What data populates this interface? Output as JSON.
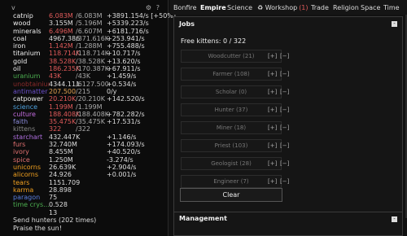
{
  "header": {
    "toggle": "v",
    "gear_icon": "⚙",
    "help": "?"
  },
  "resources": [
    {
      "name": "catnip",
      "value": "6.083M",
      "max": "/6.083M",
      "rate": "+3891.154/s [+50%]",
      "color": "#e05a5a",
      "ncolor": "#eee"
    },
    {
      "name": "wood",
      "value": "3.155M",
      "max": "/5.196M",
      "rate": "+5339.223/s",
      "color": "#ddd",
      "ncolor": "#eee"
    },
    {
      "name": "minerals",
      "value": "6.496M",
      "max": "/6.607M",
      "rate": "+6181.716/s",
      "color": "#e05a5a",
      "ncolor": "#eee"
    },
    {
      "name": "coal",
      "value": "4967.386",
      "max": "/371.616K",
      "rate": "+253.941/s",
      "color": "#ddd",
      "ncolor": "#eee"
    },
    {
      "name": "iron",
      "value": "1.142M",
      "max": "/1.288M",
      "rate": "+755.488/s",
      "color": "#e05a5a",
      "ncolor": "#eee"
    },
    {
      "name": "titanium",
      "value": "118.714K",
      "max": "/118.714K",
      "rate": "+10.717/s",
      "color": "#e05a5a",
      "ncolor": "#eee"
    },
    {
      "name": "gold",
      "value": "38.528K",
      "max": "/38.528K",
      "rate": "+13.620/s",
      "color": "#e05a5a",
      "ncolor": "#eee"
    },
    {
      "name": "oil",
      "value": "186.235K",
      "max": "/170.387K",
      "rate": "+67.911/s",
      "color": "#e05a5a",
      "ncolor": "#eee"
    },
    {
      "name": "uranium",
      "value": "43K",
      "max": "/43K",
      "rate": "+1.459/s",
      "color": "#e05a5a",
      "ncolor": "#4caf50"
    },
    {
      "name": "unobtainium",
      "value": "4344.111",
      "max": "/6127.500",
      "rate": "+0.534/s",
      "color": "#ddd",
      "ncolor": "#8b2a2a"
    },
    {
      "name": "antimatter",
      "value": "207.500",
      "max": "/215",
      "rate": "0/y",
      "color": "#e0a050",
      "ncolor": "#6a4fc8"
    },
    {
      "name": "catpower",
      "value": "20.210K",
      "max": "/20.210K",
      "rate": "+142.520/s",
      "color": "#e05a5a",
      "ncolor": "#eee"
    },
    {
      "name": "science",
      "value": "1.199M",
      "max": "/1.199M",
      "rate": "",
      "color": "#e05a5a",
      "ncolor": "#4fa3e0"
    },
    {
      "name": "culture",
      "value": "188.408K",
      "max": "/188.408K",
      "rate": "+782.282/s",
      "color": "#e05a5a",
      "ncolor": "#c56de0"
    },
    {
      "name": "faith",
      "value": "35.475K",
      "max": "/35.475K",
      "rate": "+17.531/s",
      "color": "#e05a5a",
      "ncolor": "#8a8ad8"
    },
    {
      "name": "kittens",
      "value": "322",
      "max": "/322",
      "rate": "",
      "color": "#e05a5a",
      "ncolor": "#888"
    },
    {
      "name": "starchart",
      "value": "432.447K",
      "max": "",
      "rate": "+1.146/s",
      "color": "#ddd",
      "ncolor": "#b070e0"
    },
    {
      "name": "furs",
      "value": "32.740M",
      "max": "",
      "rate": "+174.093/s",
      "color": "#ddd",
      "ncolor": "#e07070"
    },
    {
      "name": "ivory",
      "value": "8.455M",
      "max": "",
      "rate": "+40.520/s",
      "color": "#ddd",
      "ncolor": "#e07070"
    },
    {
      "name": "spice",
      "value": "1.250M",
      "max": "",
      "rate": "-3.274/s",
      "color": "#ddd",
      "ncolor": "#e07070"
    },
    {
      "name": "unicorns",
      "value": "26.639K",
      "max": "",
      "rate": "+2.904/s",
      "color": "#ddd",
      "ncolor": "#f0a020"
    },
    {
      "name": "alicorns",
      "value": "24.926",
      "max": "",
      "rate": "+0.001/s",
      "color": "#ddd",
      "ncolor": "#f0a020"
    },
    {
      "name": "tears",
      "value": "1151.709",
      "max": "",
      "rate": "",
      "color": "#ddd",
      "ncolor": "#f0a020"
    },
    {
      "name": "karma",
      "value": "28.898",
      "max": "",
      "rate": "",
      "color": "#ddd",
      "ncolor": "#f0a020"
    },
    {
      "name": "paragon",
      "value": "75",
      "max": "",
      "rate": "",
      "color": "#ddd",
      "ncolor": "#5a7fe0"
    },
    {
      "name": "time crys...",
      "value": "0.528",
      "max": "",
      "rate": "",
      "color": "#ddd",
      "ncolor": "#4caf50"
    },
    {
      "name": "",
      "value": "13",
      "max": "",
      "rate": "",
      "color": "#ddd",
      "ncolor": "#eee"
    }
  ],
  "log": [
    "Send hunters (202 times)",
    "Praise the sun!"
  ],
  "tabs": [
    {
      "label": "Bonfire",
      "active": false
    },
    {
      "label": "Empire",
      "active": true
    },
    {
      "label": "Science",
      "active": false
    },
    {
      "label": "♻ Workshop",
      "active": false,
      "badge": "(1)"
    },
    {
      "label": "Trade",
      "active": false
    },
    {
      "label": "Religion",
      "active": false
    },
    {
      "label": "Space",
      "active": false
    },
    {
      "label": "Time",
      "active": false
    }
  ],
  "jobs": {
    "title": "Jobs",
    "collapse": "-",
    "free_kittens": "Free kittens: 0 / 322",
    "list": [
      {
        "label": "Woodcutter (21)"
      },
      {
        "label": "Farmer (108)"
      },
      {
        "label": "Scholar (0)"
      },
      {
        "label": "Hunter (37)"
      },
      {
        "label": "Miner (18)"
      },
      {
        "label": "Priest (103)"
      },
      {
        "label": "Geologist (28)"
      },
      {
        "label": "Engineer (7)"
      }
    ],
    "plus": "[+]",
    "minus": "[−]",
    "clear": "Clear"
  },
  "management": {
    "title": "Management",
    "collapse": "-"
  }
}
